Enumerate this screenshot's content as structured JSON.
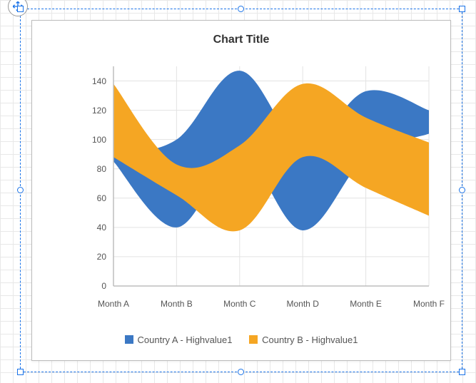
{
  "chart_data": {
    "type": "area",
    "title": "Chart Title",
    "xlabel": "",
    "ylabel": "",
    "ylim": [
      0,
      150
    ],
    "yticks": [
      0,
      20,
      40,
      60,
      80,
      100,
      120,
      140
    ],
    "categories": [
      "Month A",
      "Month B",
      "Month C",
      "Month D",
      "Month E",
      "Month F"
    ],
    "series": [
      {
        "name": "Country A - Highvalue1",
        "color": "#3b78c4",
        "high": [
          90,
          100,
          147,
          96,
          133,
          120
        ],
        "low": [
          85,
          40,
          90,
          38,
          88,
          104
        ]
      },
      {
        "name": "Country B - Highvalue1",
        "color": "#f5a623",
        "high": [
          138,
          83,
          96,
          138,
          115,
          98
        ],
        "low": [
          88,
          62,
          38,
          88,
          67,
          48
        ]
      }
    ],
    "legend_position": "bottom"
  }
}
